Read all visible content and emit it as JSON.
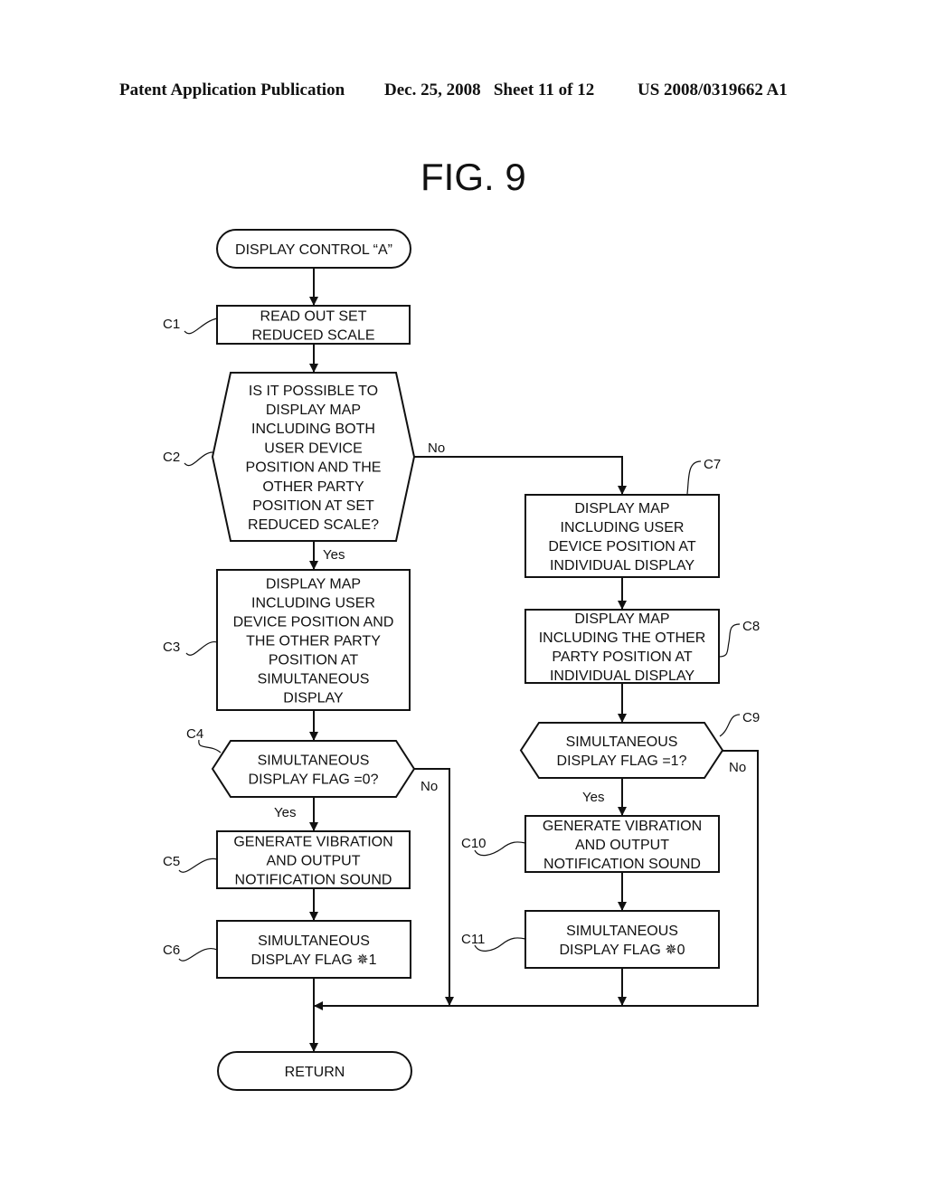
{
  "header": {
    "left": "Patent Application Publication",
    "middle": "Dec. 25, 2008   Sheet 11 of 12",
    "right": "US 2008/0319662 A1"
  },
  "figure": {
    "title": "FIG. 9"
  },
  "flowchart": {
    "start": {
      "id": "start",
      "type": "terminal",
      "lines": [
        "DISPLAY CONTROL “A”"
      ]
    },
    "steps": [
      {
        "id": "C1",
        "label": "C1",
        "type": "process",
        "lines": [
          "READ OUT SET",
          "REDUCED SCALE"
        ]
      },
      {
        "id": "C2",
        "label": "C2",
        "type": "decision",
        "lines": [
          "IS IT POSSIBLE TO",
          "DISPLAY MAP",
          "INCLUDING BOTH",
          "USER DEVICE",
          "POSITION AND THE",
          "OTHER PARTY",
          "POSITION AT SET",
          "REDUCED SCALE?"
        ],
        "yes": "C3",
        "no": "C7"
      },
      {
        "id": "C3",
        "label": "C3",
        "type": "process",
        "lines": [
          "DISPLAY MAP",
          "INCLUDING USER",
          "DEVICE POSITION AND",
          "THE OTHER PARTY",
          "POSITION AT",
          "SIMULTANEOUS",
          "DISPLAY"
        ]
      },
      {
        "id": "C4",
        "label": "C4",
        "type": "decision",
        "lines": [
          "SIMULTANEOUS",
          "DISPLAY FLAG =0?"
        ],
        "yes": "C5",
        "no": "return"
      },
      {
        "id": "C5",
        "label": "C5",
        "type": "process",
        "lines": [
          "GENERATE VIBRATION",
          "AND OUTPUT",
          "NOTIFICATION SOUND"
        ]
      },
      {
        "id": "C6",
        "label": "C6",
        "type": "process",
        "lines": [
          "SIMULTANEOUS",
          "DISPLAY FLAG ✵1"
        ]
      },
      {
        "id": "C7",
        "label": "C7",
        "type": "process",
        "lines": [
          "DISPLAY MAP",
          "INCLUDING USER",
          "DEVICE POSITION AT",
          "INDIVIDUAL DISPLAY"
        ]
      },
      {
        "id": "C8",
        "label": "C8",
        "type": "process",
        "lines": [
          "DISPLAY MAP",
          "INCLUDING THE OTHER",
          "PARTY POSITION AT",
          "INDIVIDUAL DISPLAY"
        ]
      },
      {
        "id": "C9",
        "label": "C9",
        "type": "decision",
        "lines": [
          "SIMULTANEOUS",
          "DISPLAY FLAG =1?"
        ],
        "yes": "C10",
        "no": "return"
      },
      {
        "id": "C10",
        "label": "C10",
        "type": "process",
        "lines": [
          "GENERATE VIBRATION",
          "AND OUTPUT",
          "NOTIFICATION SOUND"
        ]
      },
      {
        "id": "C11",
        "label": "C11",
        "type": "process",
        "lines": [
          "SIMULTANEOUS",
          "DISPLAY FLAG ✵0"
        ]
      }
    ],
    "end": {
      "id": "return",
      "type": "terminal",
      "lines": [
        "RETURN"
      ]
    },
    "branch_labels": {
      "yes": "Yes",
      "no": "No"
    }
  }
}
